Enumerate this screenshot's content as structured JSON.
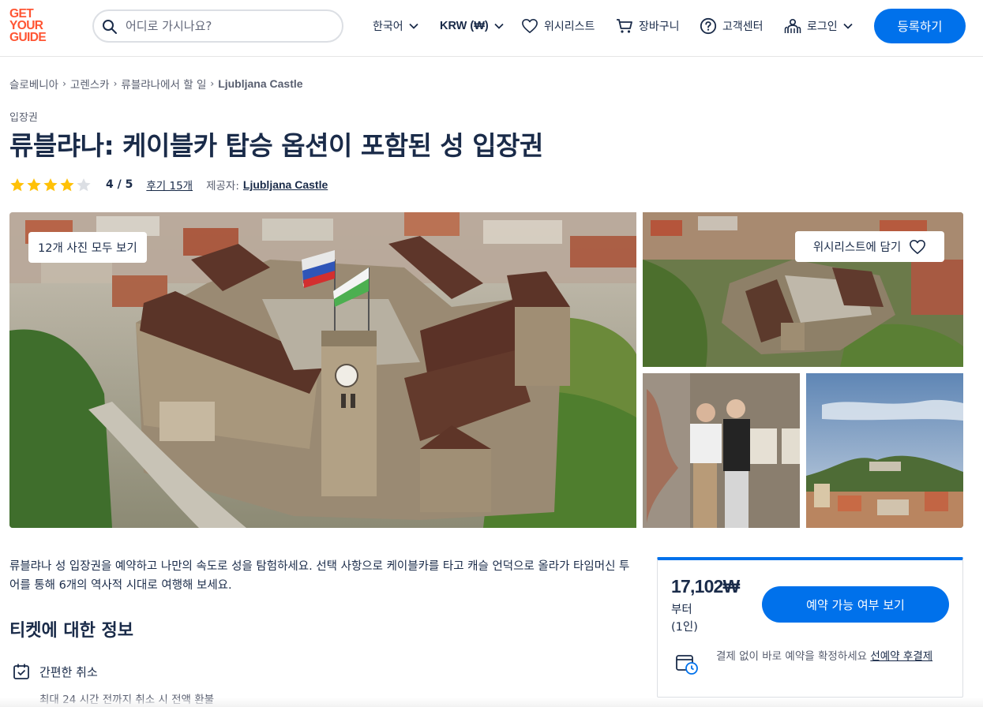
{
  "header": {
    "logo_lines": [
      "GET",
      "YOUR",
      "GUIDE"
    ],
    "search_placeholder": "어디로 가시나요?",
    "language": "한국어",
    "currency": "KRW (₩)",
    "wishlist": "위시리스트",
    "cart": "장바구니",
    "help": "고객센터",
    "login": "로그인",
    "register": "등록하기"
  },
  "breadcrumb": [
    "슬로베니아",
    "고렌스카",
    "류블랴나에서 할 일",
    "Ljubljana Castle"
  ],
  "product": {
    "category": "입장권",
    "title": "류블랴나: 케이블카 탑승 옵션이 포함된 성 입장권",
    "rating": 4,
    "rating_text": "4 / 5",
    "reviews": "후기 15개",
    "provider_label": "제공자:",
    "provider": "Ljubljana Castle"
  },
  "gallery": {
    "view_all": "12개 사진 모두 보기",
    "add_to_wishlist": "위시리스트에 담기"
  },
  "description": "류블랴나 성 입장권을 예약하고 나만의 속도로 성을 탐험하세요. 선택 사항으로 케이블카를 타고 캐슬 언덕으로 올라가 타임머신 투어를 통해 6개의 역사적 시대로 여행해 보세요.",
  "ticket_info": {
    "title": "티켓에 대한 정보",
    "feature_label": "간편한 취소",
    "feature_sub": "최대 24 시간 전까지 취소 시 전액 환불"
  },
  "booking": {
    "price": "17,102₩",
    "from": "부터",
    "per": "(1인)",
    "check_button": "예약 가능 여부 보기",
    "note": "결제 없이 바로 예약을 확정하세요",
    "note_link": "선예약 후결제"
  },
  "colors": {
    "accent": "#0071eb",
    "brand": "#ff5533",
    "text": "#1a2b49",
    "star": "#ffc107"
  }
}
